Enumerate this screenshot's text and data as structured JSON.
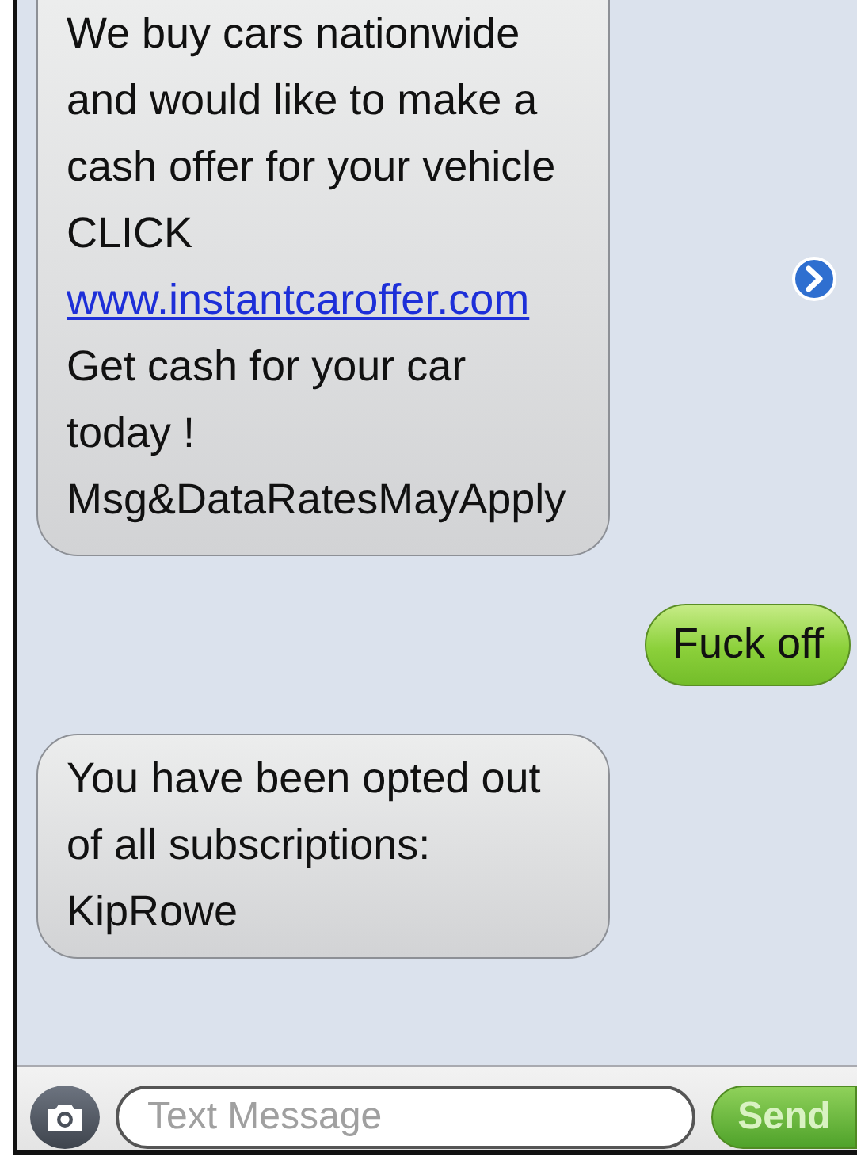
{
  "messages": [
    {
      "kind": "received",
      "details_button": true,
      "parts": [
        {
          "kind": "text",
          "text": "We buy cars nationwide and would like to make a cash offer for your vehicle CLICK"
        },
        {
          "kind": "link",
          "text": "www.instantcaroffer.com"
        },
        {
          "kind": "text",
          "text": "Get cash for your car today ! Msg&DataRatesMayApply"
        }
      ]
    },
    {
      "kind": "sent",
      "details_button": false,
      "parts": [
        {
          "kind": "text",
          "text": "Fuck off"
        }
      ]
    },
    {
      "kind": "received",
      "details_button": false,
      "parts": [
        {
          "kind": "text",
          "text": "You have been opted out of all subscriptions: KipRowe"
        }
      ]
    }
  ],
  "composer": {
    "placeholder": "Text Message",
    "send_label": "Send"
  }
}
